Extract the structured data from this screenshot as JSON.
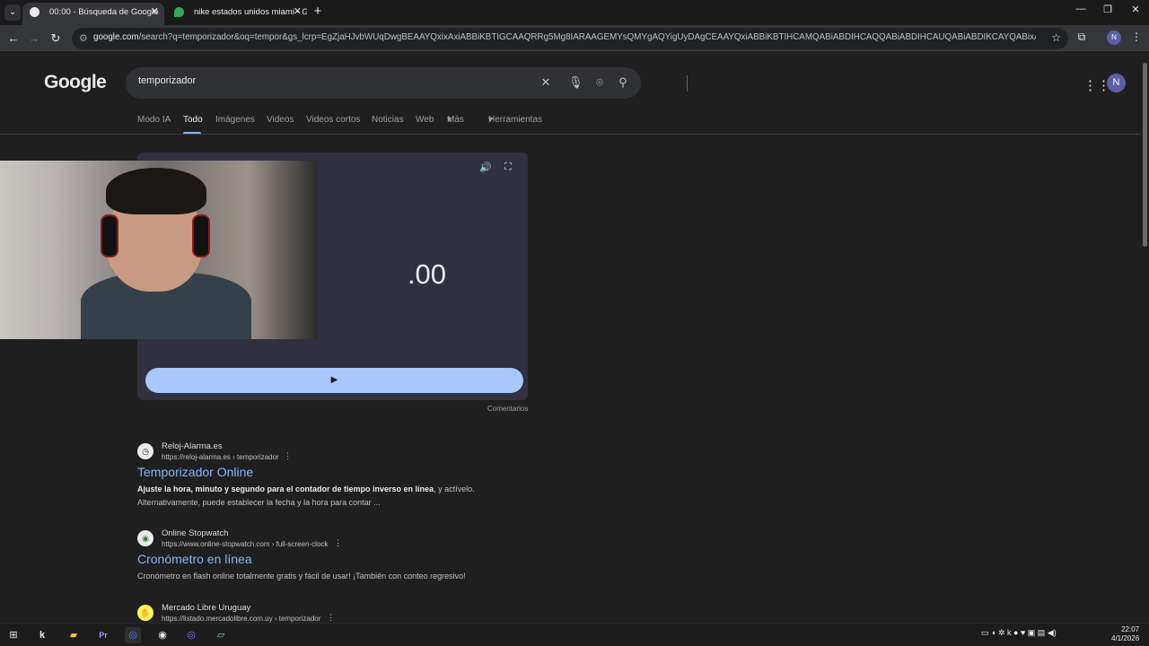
{
  "browser": {
    "tabs": [
      {
        "title": "00:00 - Búsqueda de Google",
        "active": true
      },
      {
        "title": "nike estados unidos miami - Go",
        "active": false
      }
    ],
    "url_host": "google.com",
    "url_rest": "/search?q=temporizador&oq=tempor&gs_lcrp=EgZjaHJvbWUqDwgBEAAYQxixAxiABBiKBTIGCAAQRRg5Mg8IARAAGEMYsQMYgAQYigUyDAgCEAAYQxiABBiKBTIHCAMQABiABDIHCAQQABiABDIHCAUQABiABDIKCAYQABixAxiABDIHCAcQABiABD...",
    "profile_initial": "N"
  },
  "google": {
    "logo": "Google",
    "query": "temporizador",
    "avatar_initial": "N",
    "tabs": [
      "Modo IA",
      "Todo",
      "Imágenes",
      "Videos",
      "Videos cortos",
      "Noticias",
      "Web",
      "Más",
      "Herramientas"
    ]
  },
  "timer": {
    "display": "0:00.00",
    "visible_fragment": ".00",
    "feedback": "Comentarios"
  },
  "results": [
    {
      "site": "Reloj-Alarma.es",
      "url": "https://reloj-alarma.es › temporizador",
      "title": "Temporizador Online",
      "snippet_bold": "Ajuste la hora, minuto y segundo para el contador de tiempo inverso en línea",
      "snippet_rest": ", y actívelo. Alternativamente, puede establecer la fecha y la hora para contar ..."
    },
    {
      "site": "Online Stopwatch",
      "url": "https://www.online-stopwatch.com › full-screen-clock",
      "title": "Cronómetro en línea",
      "snippet_bold": "",
      "snippet_rest": "Cronómetro en flash online totalmente gratis y fácil de usar! ¡También con conteo regresivo!"
    },
    {
      "site": "Mercado Libre Uruguay",
      "url": "https://listado.mercadolibre.com.uy › temporizador",
      "title": "",
      "snippet_bold": "",
      "snippet_rest": ""
    }
  ],
  "taskbar": {
    "time": "22:07",
    "date": "4/1/2026"
  }
}
